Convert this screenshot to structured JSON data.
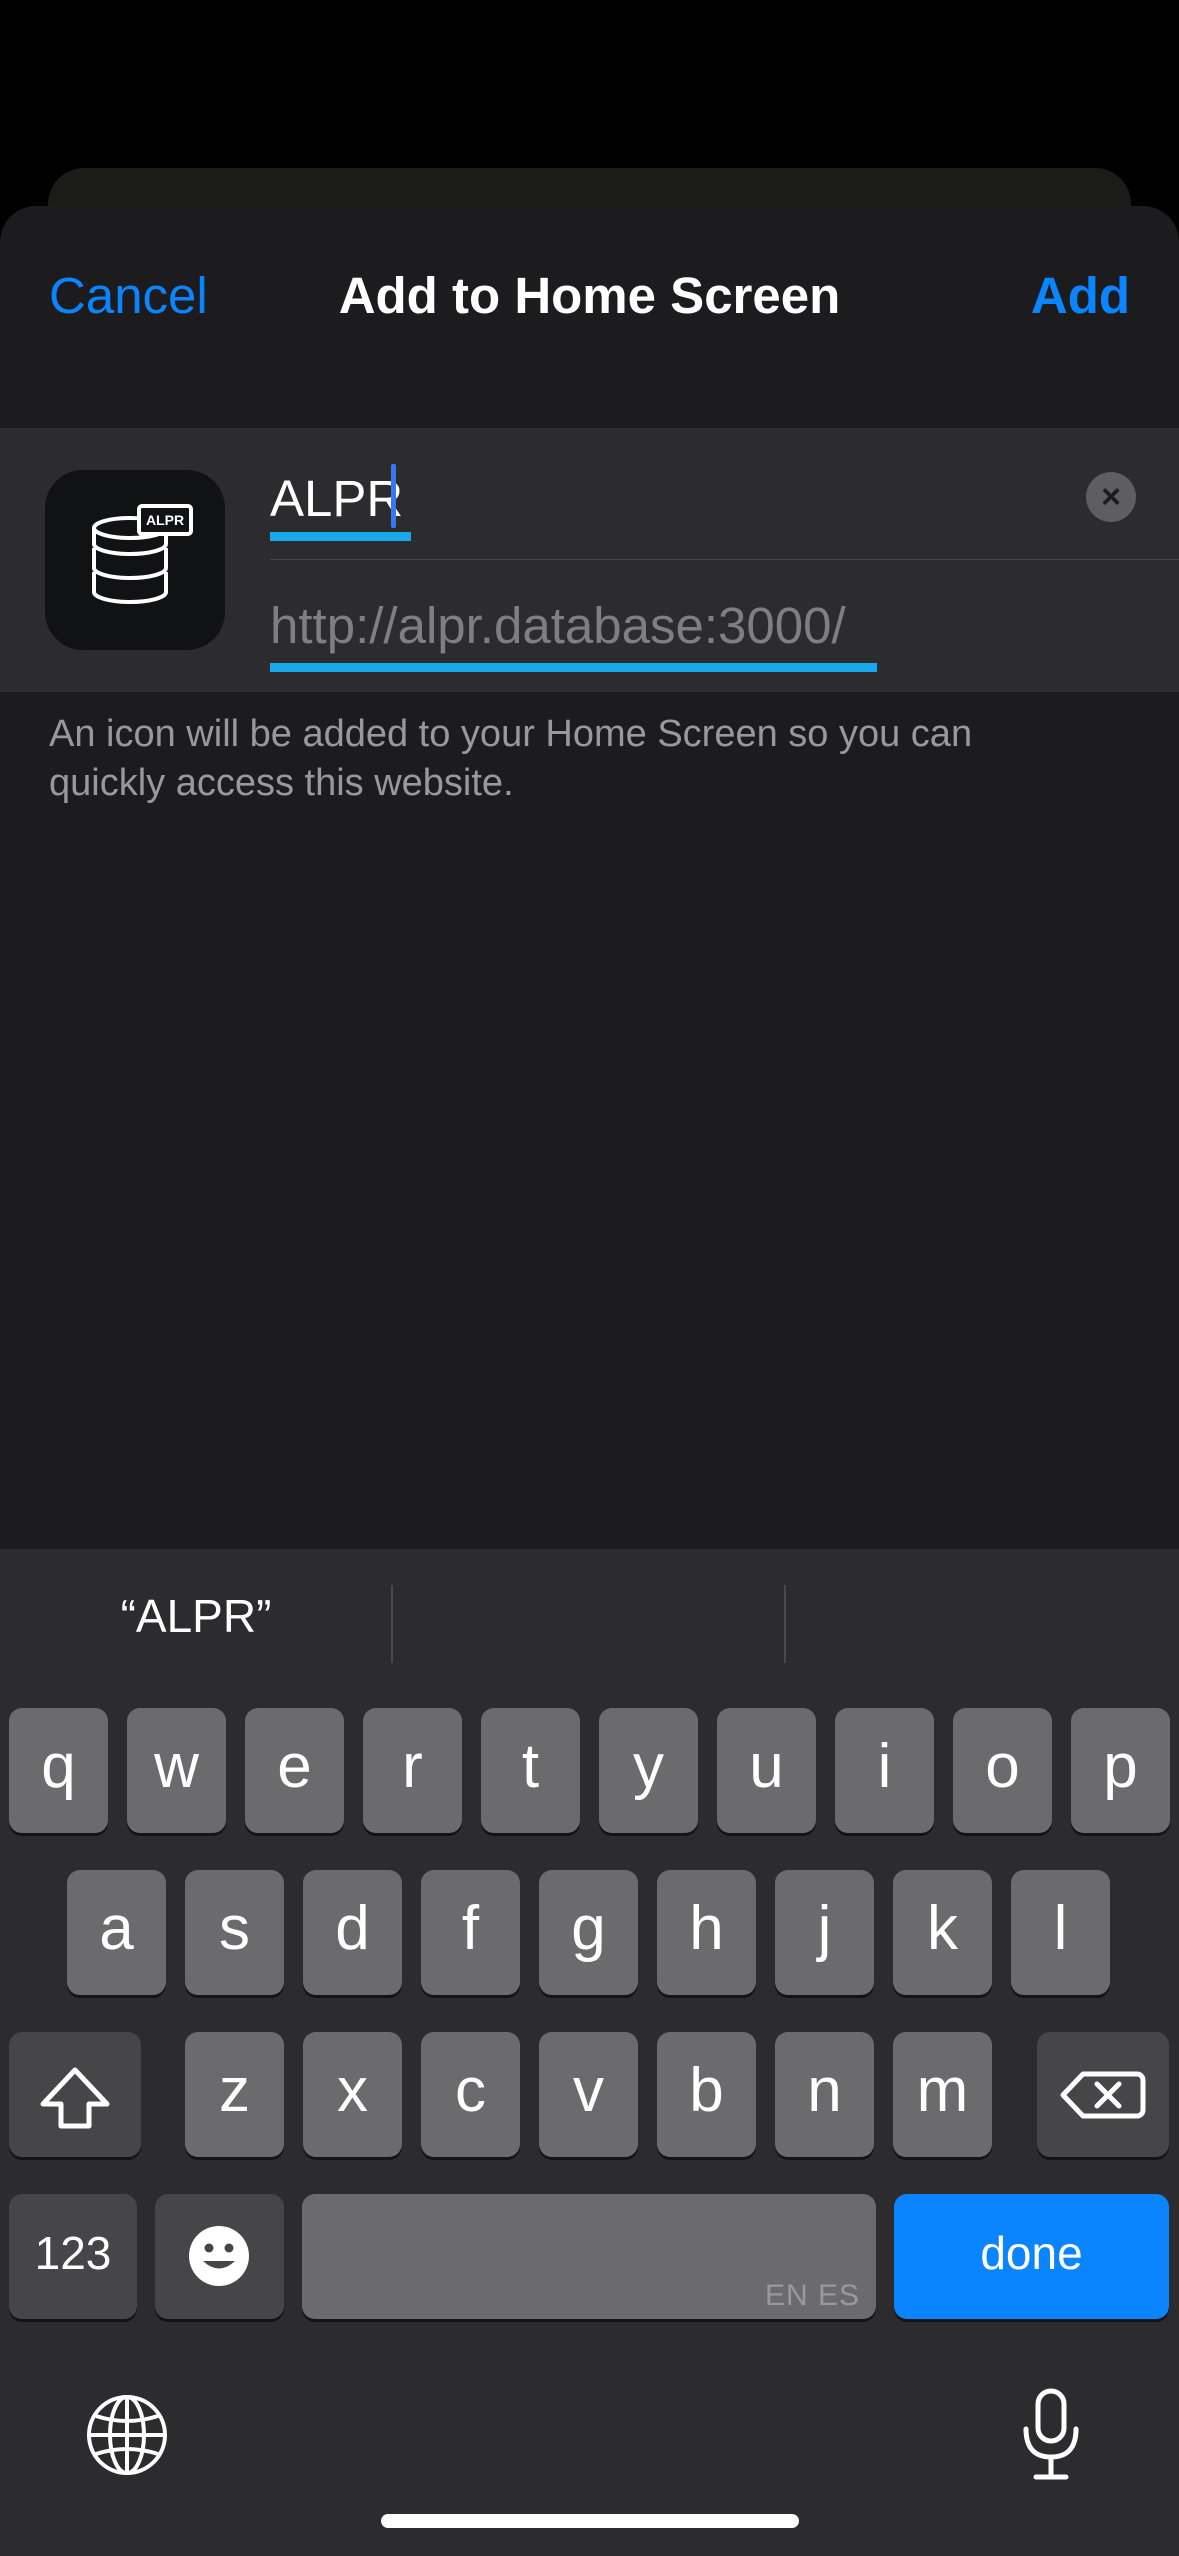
{
  "nav": {
    "cancel_label": "Cancel",
    "title": "Add to Home Screen",
    "add_label": "Add"
  },
  "form": {
    "icon_badge_text": "ALPR",
    "name_value": "ALPR",
    "clear_label": "×",
    "url_value": "http://alpr.database:3000/"
  },
  "hint_text": "An icon will be added to your Home Screen so you can quickly access this website.",
  "keyboard": {
    "suggestions": [
      "“ALPR”",
      "",
      ""
    ],
    "row1": [
      "q",
      "w",
      "e",
      "r",
      "t",
      "y",
      "u",
      "i",
      "o",
      "p"
    ],
    "row2": [
      "a",
      "s",
      "d",
      "f",
      "g",
      "h",
      "j",
      "k",
      "l"
    ],
    "row3": [
      "z",
      "x",
      "c",
      "v",
      "b",
      "n",
      "m"
    ],
    "numbers_label": "123",
    "space_lang": "EN ES",
    "done_label": "done"
  },
  "colors": {
    "accent": "#0a84ff",
    "underline": "#18a7ea",
    "sheet": "#1c1c1e",
    "keyboard": "#2c2c2e"
  }
}
